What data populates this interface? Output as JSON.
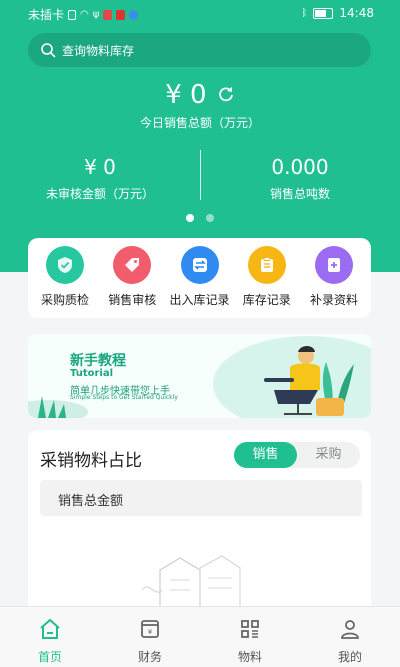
{
  "status_bar": {
    "carrier": "未插卡",
    "time": "14:48"
  },
  "search": {
    "placeholder": "查询物料库存"
  },
  "summary": {
    "total_amount": "¥ 0",
    "total_label": "今日销售总额（万元）",
    "left_value": "¥ 0",
    "left_label": "未审核金额（万元）",
    "right_value": "0.000",
    "right_label": "销售总吨数"
  },
  "carousel": {
    "page_count": 2,
    "active_index": 0
  },
  "menu": [
    {
      "label": "采购质检",
      "icon": "shield-check-icon",
      "color": "#27c8a0"
    },
    {
      "label": "销售审核",
      "icon": "tag-icon",
      "color": "#f25d6e"
    },
    {
      "label": "出入库记录",
      "icon": "transfer-icon",
      "color": "#2f8bf0"
    },
    {
      "label": "库存记录",
      "icon": "clipboard-icon",
      "color": "#f6b715"
    },
    {
      "label": "补录资料",
      "icon": "plus-doc-icon",
      "color": "#9b6bf2"
    }
  ],
  "banner": {
    "title": "新手教程",
    "title_en": "Tutorial",
    "subtitle": "简单几步快速带您上手",
    "subtitle_en": "Simple Steps to Get Started Quickly"
  },
  "chart_card": {
    "title": "采销物料占比",
    "toggle": [
      "销售",
      "采购"
    ],
    "active_toggle": 0,
    "subtotal_label": "销售总金额"
  },
  "tabbar": [
    {
      "label": "首页",
      "icon": "home-icon",
      "active": true
    },
    {
      "label": "财务",
      "icon": "finance-icon",
      "active": false
    },
    {
      "label": "物料",
      "icon": "grid-icon",
      "active": false
    },
    {
      "label": "我的",
      "icon": "user-icon",
      "active": false
    }
  ],
  "colors": {
    "brand": "#1fbf92"
  }
}
